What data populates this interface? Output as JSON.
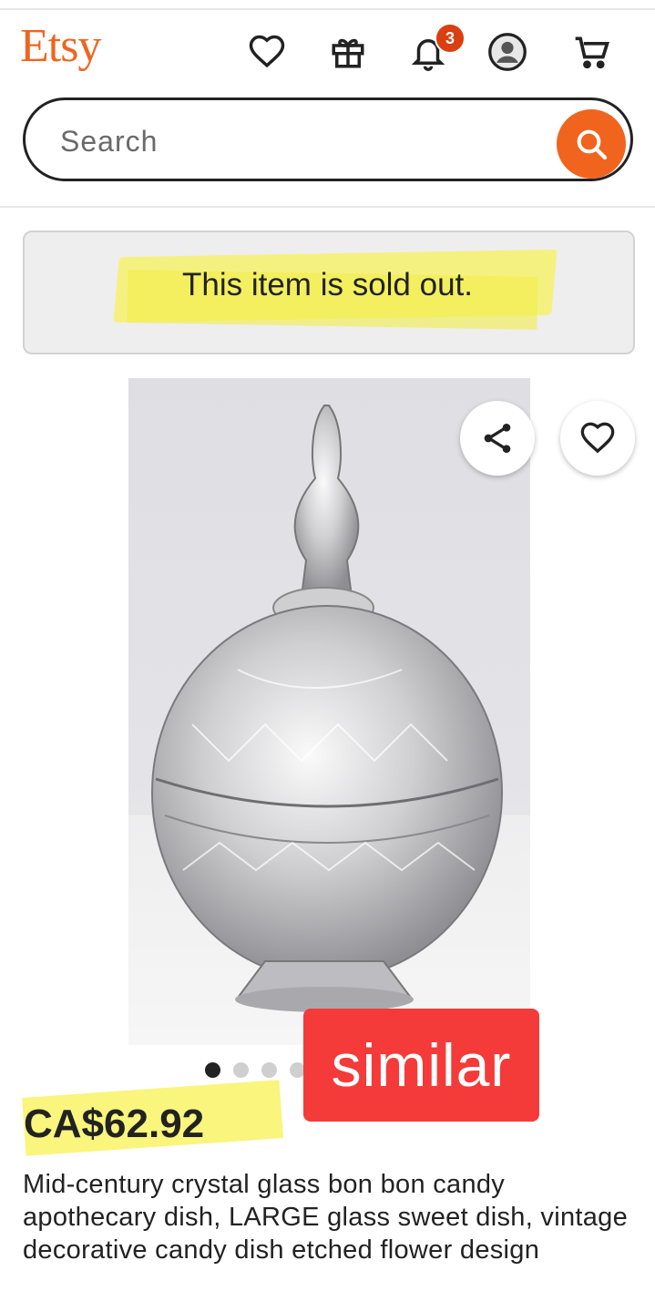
{
  "header": {
    "logo": "Etsy",
    "icons": [
      "heart-icon",
      "gift-icon",
      "bell-icon",
      "account-icon",
      "cart-icon"
    ],
    "notification_count": "3"
  },
  "search": {
    "placeholder": "Search"
  },
  "banner": {
    "sold_out_text": "This item is sold out."
  },
  "listing": {
    "image_count": 4,
    "active_image_index": 0,
    "overlay_label": "similar",
    "price": "CA$62.92",
    "title": "Mid-century crystal glass bon bon candy apothecary dish, LARGE glass sweet dish, vintage decorative candy dish etched flower design"
  },
  "colors": {
    "brand": "#f1641e",
    "badge": "#d93f11",
    "highlight": "#f7f25c",
    "overlay": "#f53a3a"
  }
}
